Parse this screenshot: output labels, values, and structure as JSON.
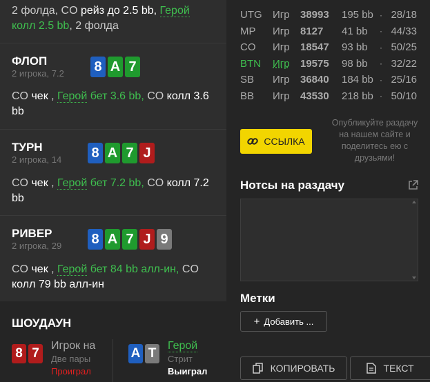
{
  "preflop": {
    "t1": "2 фолда, CO ",
    "t2": "рейз до 2.5 bb, ",
    "t3": "Герой",
    "t4": "колл 2.5 bb",
    "t5": ", 2 фолда"
  },
  "flop": {
    "title": "ФЛОП",
    "players": "2 игрока, 7.2",
    "cards": [
      "8",
      "A",
      "7"
    ],
    "a1": "CO ",
    "a2": "чек",
    ", ": "",
    "a3": "Герой",
    "a4": " бет 3.6 bb,",
    "a5": " CO ",
    "a6": "колл 3.6",
    "a7": "bb"
  },
  "turn": {
    "title": "ТУРН",
    "players": "2 игрока, 14",
    "cards": [
      "8",
      "A",
      "7",
      "J"
    ],
    "a1": "CO ",
    "a2": "чек",
    "a3": "Герой",
    "a4": " бет 7.2 bb,",
    "a5": " CO ",
    "a6": "колл 7.2",
    "a7": "bb"
  },
  "river": {
    "title": "РИВЕР",
    "players": "2 игрока, 29",
    "cards": [
      "8",
      "A",
      "7",
      "J",
      "9"
    ],
    "a1": "CO ",
    "a2": "чек",
    "a3": "Герой",
    "a4": " бет 84 bb алл-ин,",
    "a5": " CO",
    "a6": "колл 79 bb алл-ин"
  },
  "showdown": {
    "title": "ШОУДАУН",
    "p1": {
      "cards": [
        "8",
        "7"
      ],
      "name": "Игрок на",
      "hand": "Две пары",
      "result": "Проиграл"
    },
    "p2": {
      "cards": [
        "A",
        "T"
      ],
      "name": "Герой",
      "hand": "Стрит",
      "result": "Выиграл"
    }
  },
  "stats": [
    {
      "pos": "UTG",
      "igr": "Игр",
      "hands": "38993",
      "bb": "195 bb",
      "ratio": "28/18"
    },
    {
      "pos": "MP",
      "igr": "Игр",
      "hands": "8127",
      "bb": "41 bb",
      "ratio": "44/33"
    },
    {
      "pos": "CO",
      "igr": "Игр",
      "hands": "18547",
      "bb": "93 bb",
      "ratio": "50/25"
    },
    {
      "pos": "BTN",
      "igr": "Игр",
      "hands": "19575",
      "bb": "98 bb",
      "ratio": "32/22"
    },
    {
      "pos": "SB",
      "igr": "Игр",
      "hands": "36840",
      "bb": "184 bb",
      "ratio": "25/16"
    },
    {
      "pos": "BB",
      "igr": "Игр",
      "hands": "43530",
      "bb": "218 bb",
      "ratio": "50/10"
    }
  ],
  "link_btn": "ССЫЛКА",
  "share_note": "Опубликуйте раздачу на нашем сайте и поделитесь ею с друзьями!",
  "notes_title": "Нотсы на раздачу",
  "tags_title": "Метки",
  "add_btn": "Добавить ...",
  "copy_btn": "КОПИРОВАТЬ",
  "text_btn": "ТЕКСТ",
  "colors": {
    "accent": "#f2d500",
    "hero": "#3fbf4f",
    "spades": "#7a7a7a",
    "clubs": "#1f9a2e",
    "diamonds": "#1f5fbf",
    "hearts": "#b01c1c"
  }
}
